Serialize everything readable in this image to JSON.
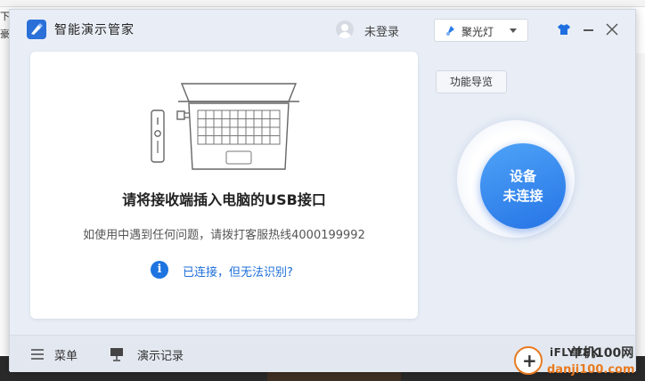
{
  "background": {
    "left_fragments": [
      "下",
      "豪"
    ]
  },
  "titlebar": {
    "app_title": "智能演示管家",
    "login_text": "未登录",
    "device_select_label": "聚光灯"
  },
  "card": {
    "main_message": "请将接收端插入电脑的USB接口",
    "help_message": "如使用中遇到任何问题，请拨打客服热线4000199992",
    "info_link": "已连接，但无法识别?"
  },
  "side": {
    "guide_button": "功能导览",
    "status_line1": "设备",
    "status_line2": "未连接"
  },
  "bottombar": {
    "menu_label": "菜单",
    "record_label": "演示记录",
    "brand": "iFLYTEK"
  },
  "watermark": {
    "site": "danji100.com",
    "name": "单机100网"
  },
  "colors": {
    "accent": "#2674e6",
    "window_bg": "#e9eef6",
    "link": "#1e6fd9"
  }
}
